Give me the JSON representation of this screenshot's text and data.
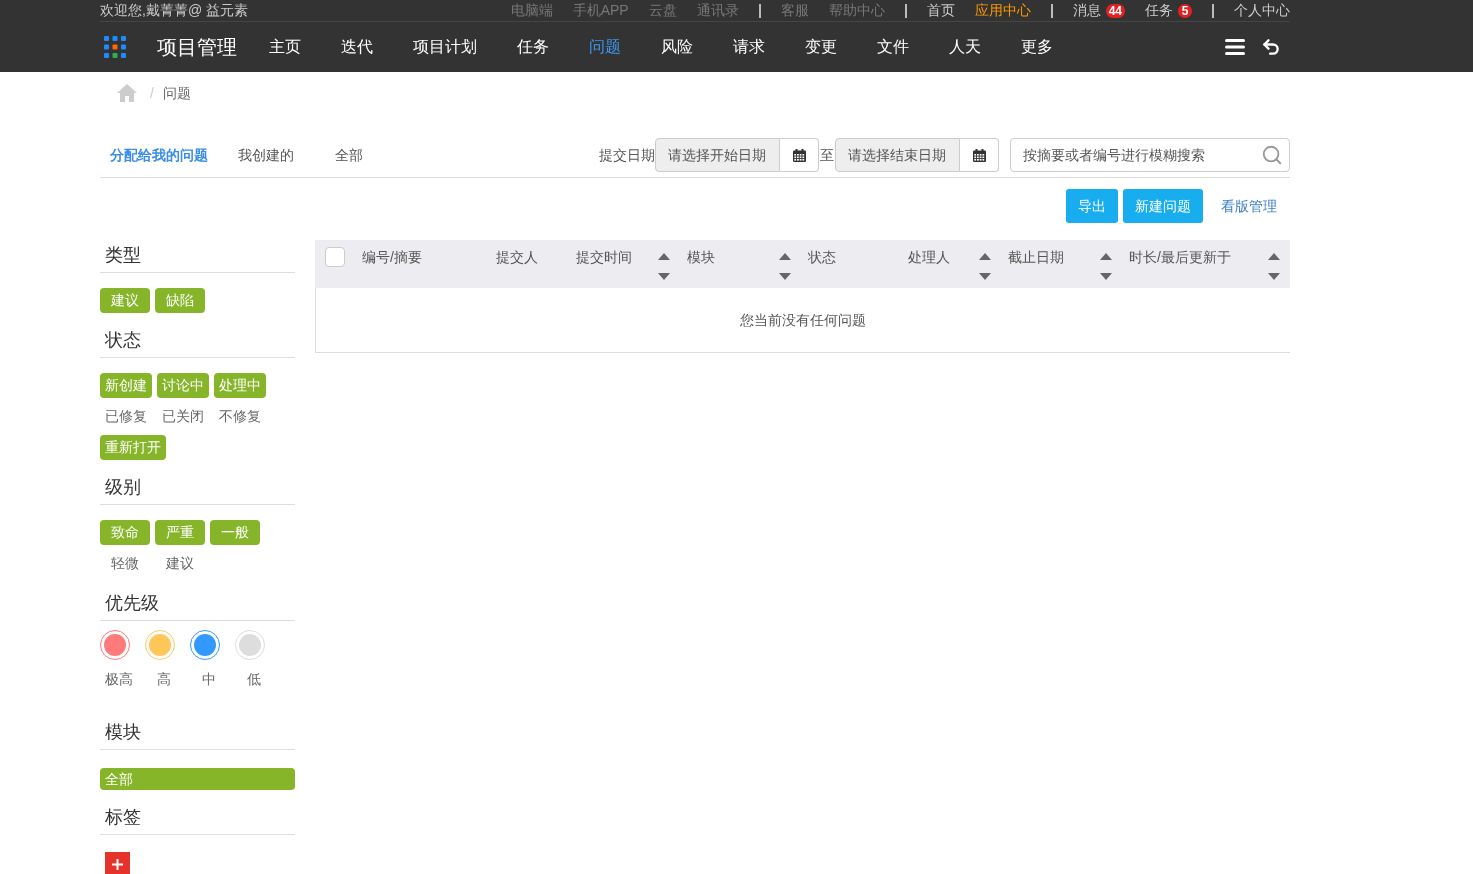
{
  "top_bar": {
    "welcome": "欢迎您,戴菁菁@ 益元素",
    "link_groups": [
      {
        "kind": "secondary",
        "links": [
          {
            "label": "电脑端",
            "selected": false
          },
          {
            "label": "手机APP",
            "selected": false
          },
          {
            "label": "云盘",
            "selected": false
          },
          {
            "label": "通讯录",
            "selected": false
          }
        ]
      },
      {
        "kind": "secondary",
        "links": [
          {
            "label": "客服",
            "selected": false
          },
          {
            "label": "帮助中心",
            "selected": false
          }
        ]
      },
      {
        "kind": "primary",
        "links": [
          {
            "label": "首页",
            "selected": false
          },
          {
            "label": "应用中心",
            "selected": true
          }
        ]
      },
      {
        "kind": "primary",
        "links": [
          {
            "label": "消息",
            "selected": false,
            "badge": "44"
          },
          {
            "label": "任务",
            "selected": false,
            "badge": "5"
          }
        ]
      },
      {
        "kind": "primary",
        "links": [
          {
            "label": "个人中心",
            "selected": false
          }
        ]
      }
    ]
  },
  "nav": {
    "title": "项目管理",
    "items": [
      {
        "label": "主页",
        "selected": false
      },
      {
        "label": "迭代",
        "selected": false
      },
      {
        "label": "项目计划",
        "selected": false
      },
      {
        "label": "任务",
        "selected": false
      },
      {
        "label": "问题",
        "selected": true
      },
      {
        "label": "风险",
        "selected": false
      },
      {
        "label": "请求",
        "selected": false
      },
      {
        "label": "变更",
        "selected": false
      },
      {
        "label": "文件",
        "selected": false
      },
      {
        "label": "人天",
        "selected": false
      },
      {
        "label": "更多",
        "selected": false
      }
    ]
  },
  "breadcrumb": {
    "separator": "/",
    "current": "问题"
  },
  "filter_bar": {
    "tabs": [
      {
        "label": "分配给我的问题",
        "selected": true
      },
      {
        "label": "我创建的",
        "selected": false
      },
      {
        "label": "全部",
        "selected": false
      }
    ],
    "date_label": "提交日期",
    "start_date": {
      "placeholder": "请选择开始日期"
    },
    "range_separator": "至",
    "end_date": {
      "placeholder": "请选择结束日期"
    },
    "search": {
      "placeholder": "按摘要或者编号进行模糊搜索"
    }
  },
  "actions": {
    "buttons": [
      "导出",
      "新建问题"
    ],
    "link": "看版管理"
  },
  "sidebar": {
    "sections": [
      {
        "title": "类型",
        "kind": "tags",
        "tags": [
          {
            "label": "建议",
            "selected": true
          },
          {
            "label": "缺陷",
            "selected": true
          }
        ]
      },
      {
        "title": "状态",
        "kind": "tags",
        "tags": [
          {
            "label": "新创建",
            "selected": true
          },
          {
            "label": "讨论中",
            "selected": true
          },
          {
            "label": "处理中",
            "selected": true
          },
          {
            "label": "已修复",
            "selected": false
          },
          {
            "label": "已关闭",
            "selected": false
          },
          {
            "label": "不修复",
            "selected": false
          },
          {
            "label": "重新打开",
            "selected": true
          }
        ]
      },
      {
        "title": "级别",
        "kind": "tags",
        "tags": [
          {
            "label": "致命",
            "selected": true
          },
          {
            "label": "严重",
            "selected": true
          },
          {
            "label": "一般",
            "selected": true
          },
          {
            "label": "轻微",
            "selected": false
          },
          {
            "label": "建议",
            "selected": false
          }
        ]
      },
      {
        "title": "优先级",
        "kind": "priority",
        "options": [
          {
            "label": "极高",
            "color": "#ff7b7b"
          },
          {
            "label": "高",
            "color": "#ffc65a"
          },
          {
            "label": "中",
            "color": "#3399ff"
          },
          {
            "label": "低",
            "color": "#dddddd"
          }
        ]
      },
      {
        "title": "模块",
        "kind": "block",
        "tags": [
          {
            "label": "全部",
            "selected": true
          }
        ]
      },
      {
        "title": "标签",
        "kind": "add"
      }
    ]
  },
  "table": {
    "select_all": {
      "checked": false
    },
    "columns": [
      {
        "label": "编号/摘要",
        "sortable": false
      },
      {
        "label": "提交人",
        "sortable": false
      },
      {
        "label": "提交时间",
        "sortable": true
      },
      {
        "label": "模块",
        "sortable": true
      },
      {
        "label": "状态",
        "sortable": false
      },
      {
        "label": "处理人",
        "sortable": true
      },
      {
        "label": "截止日期",
        "sortable": true
      },
      {
        "label": "时长/最后更新于",
        "sortable": true
      }
    ],
    "empty_message": "您当前没有任何问题"
  }
}
